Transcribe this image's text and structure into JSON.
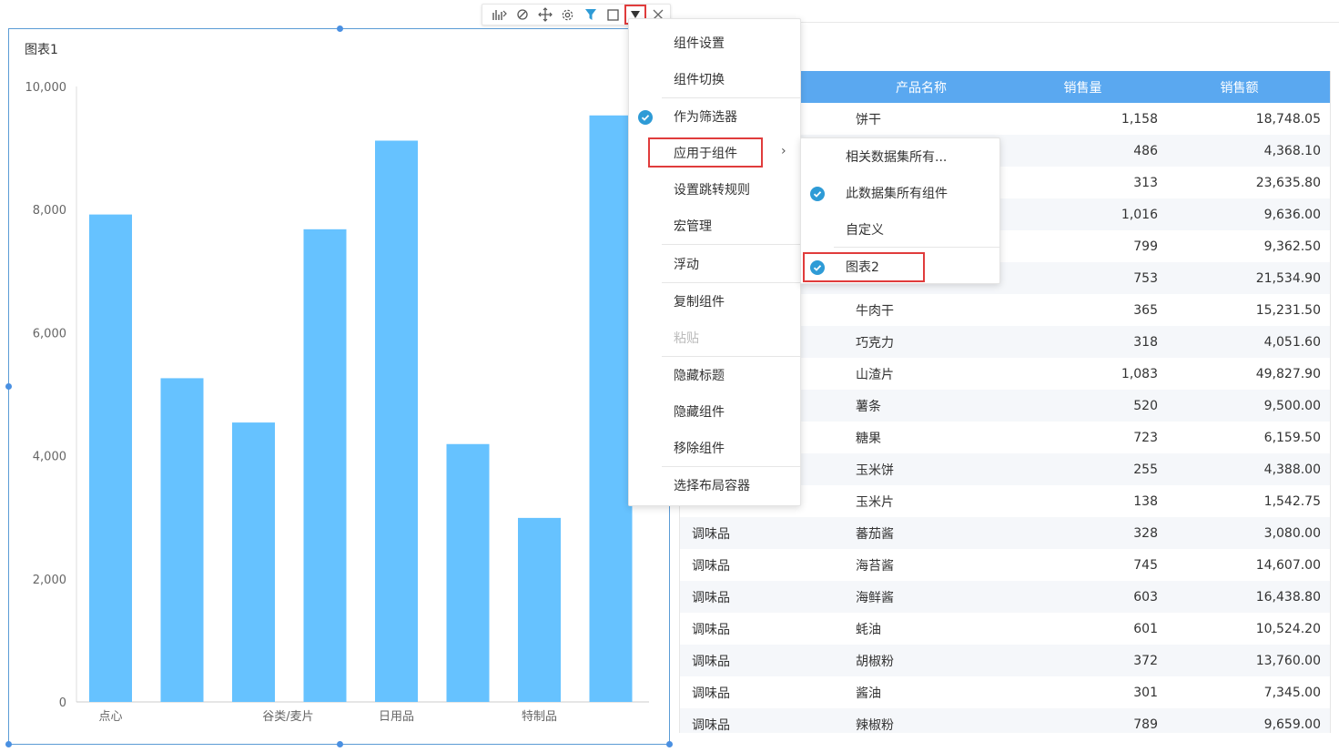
{
  "chart": {
    "title": "图表1"
  },
  "chart_data": {
    "type": "bar",
    "categories": [
      "点心",
      "",
      "谷类/麦片",
      "",
      "日用品",
      "",
      "特制品",
      "",
      ""
    ],
    "tick_labels_shown": [
      "点心",
      "谷类/麦片",
      "日用品",
      "特制品"
    ],
    "values": [
      7920,
      5260,
      4540,
      7680,
      9120,
      4190,
      2990,
      9530
    ],
    "yticks": [
      "0",
      "2,000",
      "4,000",
      "6,000",
      "8,000",
      "10,000"
    ],
    "ylim": [
      0,
      10000
    ],
    "bar_color": "#66c2ff",
    "grid": false
  },
  "table": {
    "headers": [
      "",
      "产品名称",
      "销售量",
      "销售额"
    ],
    "rows": [
      [
        "",
        "饼干",
        "1,158",
        "18,748.05"
      ],
      [
        "",
        "",
        "486",
        "4,368.10"
      ],
      [
        "",
        "",
        "313",
        "23,635.80"
      ],
      [
        "",
        "",
        "1,016",
        "9,636.00"
      ],
      [
        "",
        "",
        "799",
        "9,362.50"
      ],
      [
        "",
        "",
        "753",
        "21,534.90"
      ],
      [
        "",
        "牛肉干",
        "365",
        "15,231.50"
      ],
      [
        "",
        "巧克力",
        "318",
        "4,051.60"
      ],
      [
        "",
        "山渣片",
        "1,083",
        "49,827.90"
      ],
      [
        "",
        "薯条",
        "520",
        "9,500.00"
      ],
      [
        "",
        "糖果",
        "723",
        "6,159.50"
      ],
      [
        "",
        "玉米饼",
        "255",
        "4,388.00"
      ],
      [
        "",
        "玉米片",
        "138",
        "1,542.75"
      ],
      [
        "调味品",
        "蕃茄酱",
        "328",
        "3,080.00"
      ],
      [
        "调味品",
        "海苔酱",
        "745",
        "14,607.00"
      ],
      [
        "调味品",
        "海鲜酱",
        "603",
        "16,438.80"
      ],
      [
        "调味品",
        "蚝油",
        "601",
        "10,524.20"
      ],
      [
        "调味品",
        "胡椒粉",
        "372",
        "13,760.00"
      ],
      [
        "调味品",
        "酱油",
        "301",
        "7,345.00"
      ],
      [
        "调味品",
        "辣椒粉",
        "789",
        "9,659.00"
      ]
    ]
  },
  "toolbar": {
    "icons": [
      "chart-type-icon",
      "style-icon",
      "move-icon",
      "settings-icon",
      "filter-icon",
      "maximize-icon",
      "dropdown-icon",
      "close-icon"
    ]
  },
  "menu": {
    "items": [
      "组件设置",
      "组件切换",
      "作为筛选器",
      "应用于组件",
      "设置跳转规则",
      "宏管理",
      "浮动",
      "复制组件",
      "粘贴",
      "隐藏标题",
      "隐藏组件",
      "移除组件",
      "选择布局容器"
    ]
  },
  "submenu": {
    "items": [
      "相关数据集所有...",
      "此数据集所有组件",
      "自定义",
      "图表2"
    ]
  },
  "colors": {
    "accent": "#4a90e2",
    "check": "#2e9bd6",
    "highlight": "#e03c3c",
    "table_header": "#5aa8f0"
  }
}
